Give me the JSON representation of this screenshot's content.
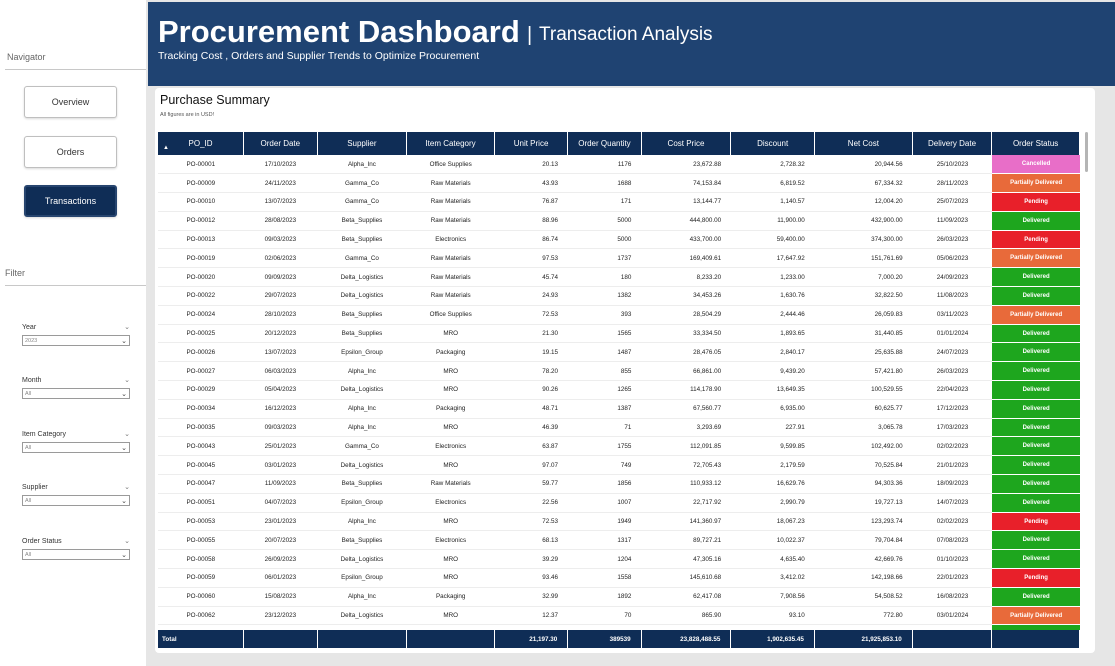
{
  "sidebar": {
    "navigator_label": "Navigator",
    "nav": [
      {
        "label": "Overview",
        "active": false
      },
      {
        "label": "Orders",
        "active": false
      },
      {
        "label": "Transactions",
        "active": true
      }
    ],
    "filter_label": "Filter",
    "slicers": [
      {
        "label": "Year",
        "value": "2023"
      },
      {
        "label": "Month",
        "value": "All"
      },
      {
        "label": "Item Category",
        "value": "All"
      },
      {
        "label": "Supplier",
        "value": "All"
      },
      {
        "label": "Order Status",
        "value": "All"
      }
    ]
  },
  "header": {
    "title": "Procurement Dashboard",
    "separator": "|",
    "subtitle": "Transaction Analysis",
    "tagline": "Tracking Cost , Orders and Supplier Trends to Optimize Procurement"
  },
  "panel": {
    "title": "Purchase Summary",
    "note": "All figures are in USD!"
  },
  "colors": {
    "navy": "#0f2d56",
    "header": "#1f4372",
    "delivered": "#1ea61e",
    "pending": "#e8202a",
    "partially_delivered": "#e86a3a",
    "cancelled": "#e86ec8"
  },
  "table": {
    "columns": [
      "PO_ID",
      "Order Date",
      "Supplier",
      "Item Category",
      "Unit Price",
      "Order Quantity",
      "Cost Price",
      "Discount",
      "Net Cost",
      "Delivery Date",
      "Order Status"
    ],
    "rows": [
      [
        "PO-00001",
        "17/10/2023",
        "Alpha_Inc",
        "Office Supplies",
        "20.13",
        "1176",
        "23,672.88",
        "2,728.32",
        "20,944.56",
        "25/10/2023",
        "Cancelled"
      ],
      [
        "PO-00009",
        "24/11/2023",
        "Gamma_Co",
        "Raw Materials",
        "43.93",
        "1688",
        "74,153.84",
        "6,819.52",
        "67,334.32",
        "28/11/2023",
        "Partially Delivered"
      ],
      [
        "PO-00010",
        "13/07/2023",
        "Gamma_Co",
        "Raw Materials",
        "76.87",
        "171",
        "13,144.77",
        "1,140.57",
        "12,004.20",
        "25/07/2023",
        "Pending"
      ],
      [
        "PO-00012",
        "28/08/2023",
        "Beta_Supplies",
        "Raw Materials",
        "88.96",
        "5000",
        "444,800.00",
        "11,900.00",
        "432,900.00",
        "11/09/2023",
        "Delivered"
      ],
      [
        "PO-00013",
        "09/03/2023",
        "Beta_Supplies",
        "Electronics",
        "86.74",
        "5000",
        "433,700.00",
        "59,400.00",
        "374,300.00",
        "26/03/2023",
        "Pending"
      ],
      [
        "PO-00019",
        "02/06/2023",
        "Gamma_Co",
        "Raw Materials",
        "97.53",
        "1737",
        "169,409.61",
        "17,647.92",
        "151,761.69",
        "05/06/2023",
        "Partially Delivered"
      ],
      [
        "PO-00020",
        "09/09/2023",
        "Delta_Logistics",
        "Raw Materials",
        "45.74",
        "180",
        "8,233.20",
        "1,233.00",
        "7,000.20",
        "24/09/2023",
        "Delivered"
      ],
      [
        "PO-00022",
        "29/07/2023",
        "Delta_Logistics",
        "Raw Materials",
        "24.93",
        "1382",
        "34,453.26",
        "1,630.76",
        "32,822.50",
        "11/08/2023",
        "Delivered"
      ],
      [
        "PO-00024",
        "28/10/2023",
        "Beta_Supplies",
        "Office Supplies",
        "72.53",
        "393",
        "28,504.29",
        "2,444.46",
        "26,059.83",
        "03/11/2023",
        "Partially Delivered"
      ],
      [
        "PO-00025",
        "20/12/2023",
        "Beta_Supplies",
        "MRO",
        "21.30",
        "1565",
        "33,334.50",
        "1,893.65",
        "31,440.85",
        "01/01/2024",
        "Delivered"
      ],
      [
        "PO-00026",
        "13/07/2023",
        "Epsilon_Group",
        "Packaging",
        "19.15",
        "1487",
        "28,476.05",
        "2,840.17",
        "25,635.88",
        "24/07/2023",
        "Delivered"
      ],
      [
        "PO-00027",
        "06/03/2023",
        "Alpha_Inc",
        "MRO",
        "78.20",
        "855",
        "66,861.00",
        "9,439.20",
        "57,421.80",
        "26/03/2023",
        "Delivered"
      ],
      [
        "PO-00029",
        "05/04/2023",
        "Delta_Logistics",
        "MRO",
        "90.26",
        "1265",
        "114,178.90",
        "13,649.35",
        "100,529.55",
        "22/04/2023",
        "Delivered"
      ],
      [
        "PO-00034",
        "16/12/2023",
        "Alpha_Inc",
        "Packaging",
        "48.71",
        "1387",
        "67,560.77",
        "6,935.00",
        "60,625.77",
        "17/12/2023",
        "Delivered"
      ],
      [
        "PO-00035",
        "09/03/2023",
        "Alpha_Inc",
        "MRO",
        "46.39",
        "71",
        "3,293.69",
        "227.91",
        "3,065.78",
        "17/03/2023",
        "Delivered"
      ],
      [
        "PO-00043",
        "25/01/2023",
        "Gamma_Co",
        "Electronics",
        "63.87",
        "1755",
        "112,091.85",
        "9,599.85",
        "102,492.00",
        "02/02/2023",
        "Delivered"
      ],
      [
        "PO-00045",
        "03/01/2023",
        "Delta_Logistics",
        "MRO",
        "97.07",
        "749",
        "72,705.43",
        "2,179.59",
        "70,525.84",
        "21/01/2023",
        "Delivered"
      ],
      [
        "PO-00047",
        "11/09/2023",
        "Beta_Supplies",
        "Raw Materials",
        "59.77",
        "1856",
        "110,933.12",
        "16,629.76",
        "94,303.36",
        "18/09/2023",
        "Delivered"
      ],
      [
        "PO-00051",
        "04/07/2023",
        "Epsilon_Group",
        "Electronics",
        "22.56",
        "1007",
        "22,717.92",
        "2,990.79",
        "19,727.13",
        "14/07/2023",
        "Delivered"
      ],
      [
        "PO-00053",
        "23/01/2023",
        "Alpha_Inc",
        "MRO",
        "72.53",
        "1949",
        "141,360.97",
        "18,067.23",
        "123,293.74",
        "02/02/2023",
        "Pending"
      ],
      [
        "PO-00055",
        "20/07/2023",
        "Beta_Supplies",
        "Electronics",
        "68.13",
        "1317",
        "89,727.21",
        "10,022.37",
        "79,704.84",
        "07/08/2023",
        "Delivered"
      ],
      [
        "PO-00058",
        "26/09/2023",
        "Delta_Logistics",
        "MRO",
        "39.29",
        "1204",
        "47,305.16",
        "4,635.40",
        "42,669.76",
        "01/10/2023",
        "Delivered"
      ],
      [
        "PO-00059",
        "06/01/2023",
        "Epsilon_Group",
        "MRO",
        "93.46",
        "1558",
        "145,610.68",
        "3,412.02",
        "142,198.66",
        "22/01/2023",
        "Pending"
      ],
      [
        "PO-00060",
        "15/08/2023",
        "Alpha_Inc",
        "Packaging",
        "32.99",
        "1892",
        "62,417.08",
        "7,908.56",
        "54,508.52",
        "16/08/2023",
        "Delivered"
      ],
      [
        "PO-00062",
        "23/12/2023",
        "Delta_Logistics",
        "MRO",
        "12.37",
        "70",
        "865.90",
        "93.10",
        "772.80",
        "03/01/2024",
        "Partially Delivered"
      ],
      [
        "PO-00065",
        "09/11/2023",
        "Delta_Logistics",
        "Packaging",
        "100.13",
        "1347",
        "134,875.11",
        "7,853.01",
        "127,022.10",
        "12/11/2023",
        "Delivered"
      ]
    ],
    "total": {
      "label": "Total",
      "unit_price": "21,197.30",
      "order_quantity": "389539",
      "cost_price": "23,828,488.55",
      "discount": "1,902,635.45",
      "net_cost": "21,925,853.10"
    }
  }
}
